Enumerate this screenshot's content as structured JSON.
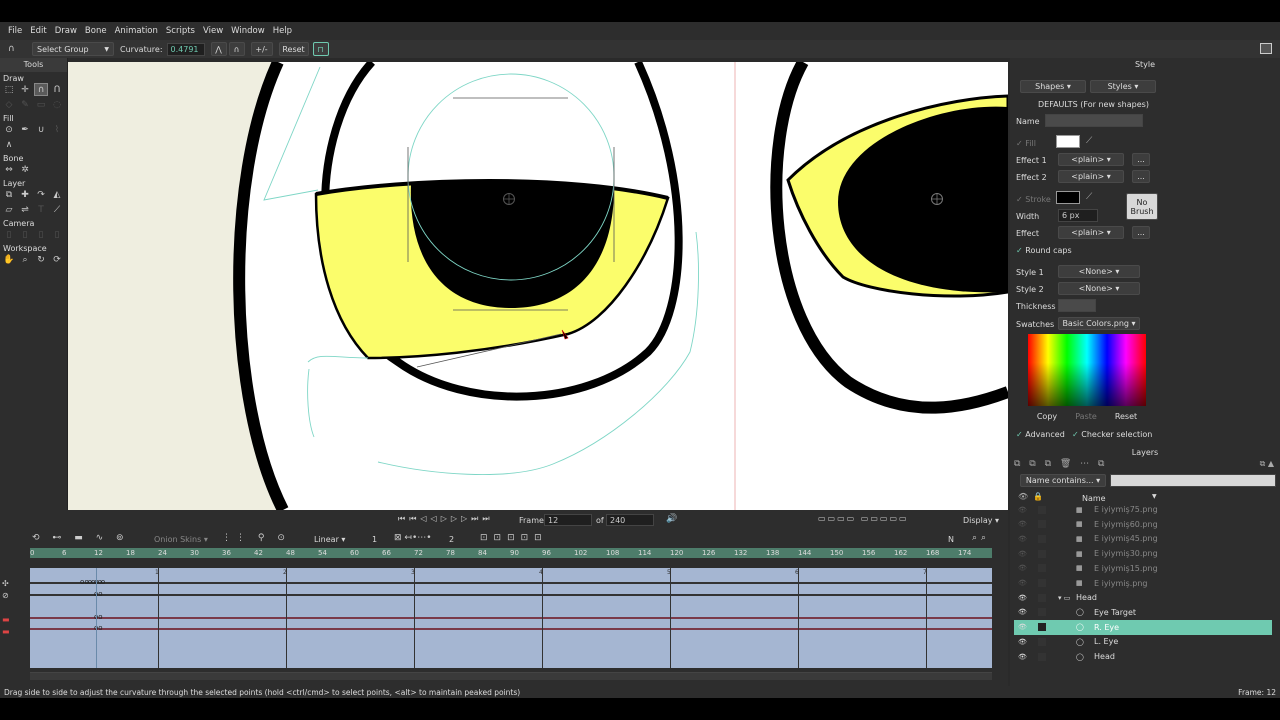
{
  "menu": {
    "items": [
      "File",
      "Edit",
      "Draw",
      "Bone",
      "Animation",
      "Scripts",
      "View",
      "Window",
      "Help"
    ]
  },
  "tool_options": {
    "mode_label": "Select Group",
    "curvature_label": "Curvature:",
    "curvature_value": "0.4791",
    "plusminus_label": "+/-",
    "reset_label": "Reset"
  },
  "tools": {
    "title": "Tools",
    "sections": [
      "Draw",
      "Fill",
      "Bone",
      "Layer",
      "Camera",
      "Workspace"
    ]
  },
  "style": {
    "title": "Style",
    "shapes_label": "Shapes",
    "styles_label": "Styles",
    "defaults_label": "DEFAULTS (For new shapes)",
    "name_label": "Name",
    "fill_label": "Fill",
    "effect1_label": "Effect 1",
    "effect2_label": "Effect 2",
    "effect1_value": "<plain>",
    "effect2_value": "<plain>",
    "stroke_label": "Stroke",
    "width_label": "Width",
    "width_value": "6 px",
    "effect_label": "Effect",
    "effect_value": "<plain>",
    "no_brush_label": "No Brush",
    "round_caps_label": "Round caps",
    "style1_label": "Style 1",
    "style1_value": "<None>",
    "style2_label": "Style 2",
    "style2_value": "<None>",
    "thickness_label": "Thickness",
    "swatches_label": "Swatches",
    "swatches_value": "Basic Colors.png",
    "copy_label": "Copy",
    "paste_label": "Paste",
    "reset_label": "Reset",
    "advanced_label": "Advanced",
    "checker_label": "Checker selection",
    "fill_color": "#ffffff",
    "stroke_color": "#000000"
  },
  "layers": {
    "title": "Layers",
    "filter_label": "Name contains...",
    "name_column": "Name",
    "rows": [
      {
        "label": "E iyiymiş75.png",
        "indent": 1,
        "dim": true
      },
      {
        "label": "E iyiymiş60.png",
        "indent": 1,
        "dim": true
      },
      {
        "label": "E iyiymiş45.png",
        "indent": 1,
        "dim": true
      },
      {
        "label": "E iyiymiş30.png",
        "indent": 1,
        "dim": true
      },
      {
        "label": "E iyiymiş15.png",
        "indent": 1,
        "dim": true
      },
      {
        "label": "E iyiymiş.png",
        "indent": 1,
        "dim": true
      },
      {
        "label": "Head",
        "indent": 0,
        "dim": false
      },
      {
        "label": "Eye Target",
        "indent": 1,
        "dim": false
      },
      {
        "label": "R. Eye",
        "indent": 1,
        "dim": false,
        "selected": true
      },
      {
        "label": "L. Eye",
        "indent": 1,
        "dim": false
      },
      {
        "label": "Head",
        "indent": 1,
        "dim": false
      }
    ]
  },
  "timeline": {
    "onion_label": "Onion Skins",
    "interp_label": "Linear",
    "interp_num": "1",
    "num2": "2",
    "frame_label": "Frame",
    "frame_value": "12",
    "of_label": "of",
    "total_frames": "240",
    "display_label": "Display",
    "n_label": "N",
    "ruler": [
      "0",
      "6",
      "12",
      "18",
      "24",
      "30",
      "36",
      "42",
      "48",
      "54",
      "60",
      "66",
      "72",
      "78",
      "84",
      "90",
      "96",
      "102",
      "108",
      "114",
      "120",
      "126",
      "132",
      "138",
      "144",
      "150",
      "156",
      "162",
      "168",
      "174"
    ],
    "marks": [
      "1",
      "2",
      "3",
      "4",
      "5",
      "6",
      "7"
    ]
  },
  "status": {
    "message": "Drag side to side to adjust the curvature through the selected points (hold <ctrl/cmd> to select points, <alt> to maintain peaked points)",
    "frame_info": "Frame: 12"
  },
  "colors": {
    "accent": "#6fcab0",
    "eye_yellow": "#fbfd6b",
    "timeline_bg": "#a5b6d2",
    "curve": "#7ed6c6"
  }
}
